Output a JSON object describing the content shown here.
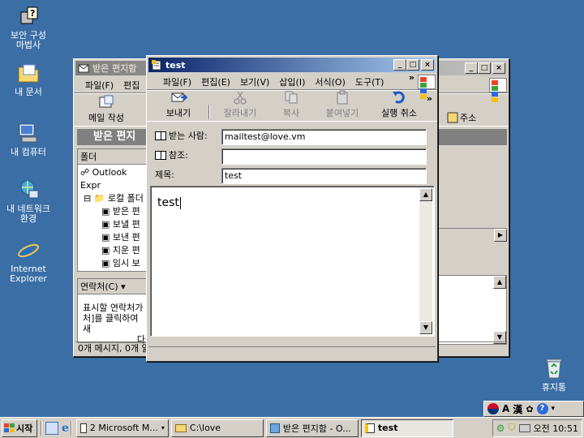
{
  "desktop": {
    "icons": [
      {
        "label": "보안 구성\n마법사"
      },
      {
        "label": "내 문서"
      },
      {
        "label": "내 컴퓨터"
      },
      {
        "label": "내 네트워크\n환경"
      },
      {
        "label": "Internet\nExplorer"
      },
      {
        "label": "휴지통"
      }
    ]
  },
  "outlook": {
    "title": "받은 편지함",
    "menu_file": "파일(F)",
    "menu_edit": "편집",
    "toolbar_new_mail": "메일 작성",
    "folder_header": "받은 편지",
    "folders_label": "폴더",
    "tree_root": "Outlook Expr",
    "tree_local": "로컬 폴더",
    "tree_inbox": "받은 편",
    "tree_outbox": "보낼 편",
    "tree_sent": "보낸 편",
    "tree_deleted": "지운 편",
    "tree_drafts": "임시 보",
    "contacts_label": "연락처(C)",
    "contacts_text1": "표시할 연락처가",
    "contacts_text2": "처]를 클릭하여 새",
    "contacts_text3": "다",
    "right_toolbar_label": "주소",
    "status": "0개 메시지, 0개 읽"
  },
  "compose": {
    "title": "test",
    "menu": [
      "파일(F)",
      "편집(E)",
      "보기(V)",
      "삽입(I)",
      "서식(O)",
      "도구(T)"
    ],
    "menu_more": "»",
    "toolbar": {
      "send": "보내기",
      "cut": "잘라내기",
      "copy": "복사",
      "paste": "붙여넣기",
      "undo": "실행 취소",
      "more": "»"
    },
    "to_label": "받는 사람:",
    "to_value": "mailtest@love.vm",
    "cc_label": "참조:",
    "cc_value": "",
    "subject_label": "제목:",
    "subject_value": "test",
    "body_text": "test"
  },
  "taskbar": {
    "start": "시작",
    "tasks": [
      {
        "label": "2 Microsoft M..."
      },
      {
        "label": "C:\\love"
      },
      {
        "label": "받은 편지함 - O..."
      },
      {
        "label": "test"
      }
    ],
    "clock": "오전 10:51"
  },
  "ime": {
    "a": "A",
    "han": "漢"
  }
}
